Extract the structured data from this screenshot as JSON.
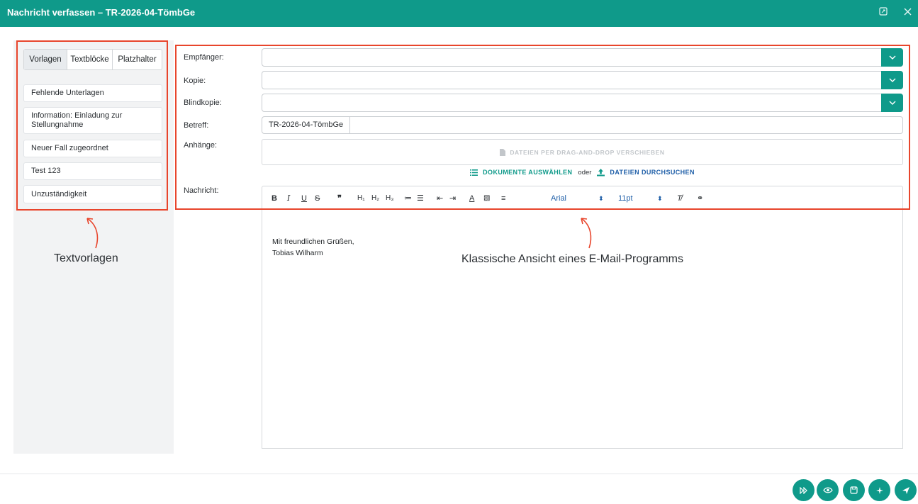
{
  "window": {
    "title": "Nachricht verfassen – TR-2026-04-TömbGe",
    "maximize_icon": "maximize-icon",
    "close_icon": "close-icon"
  },
  "sidebar": {
    "tabs": [
      {
        "label": "Vorlagen",
        "active": true
      },
      {
        "label": "Textblöcke",
        "active": false
      },
      {
        "label": "Platzhalter",
        "active": false
      }
    ],
    "templates": [
      {
        "label": "Fehlende Unterlagen"
      },
      {
        "label": "Information: Einladung zur Stellungnahme"
      },
      {
        "label": "Neuer Fall zugeordnet"
      },
      {
        "label": "Test 123"
      },
      {
        "label": "Unzuständigkeit"
      }
    ]
  },
  "form": {
    "recipient_label": "Empfänger:",
    "recipient_value": "",
    "cc_label": "Kopie:",
    "cc_value": "",
    "bcc_label": "Blindkopie:",
    "bcc_value": "",
    "subject_label": "Betreff:",
    "subject_value": "TR-2026-04-TömbGe",
    "attachments_label": "Anhänge:",
    "dropzone_text": "DATEIEN PER DRAG-AND-DROP VERSCHIEBEN",
    "select_documents": "DOKUMENTE AUSWÄHLEN",
    "or_text": "oder",
    "browse_files": "DATEIEN DURCHSUCHEN",
    "message_label": "Nachricht:"
  },
  "editor": {
    "font": "Arial",
    "size": "11pt",
    "body_lines": [
      "Mit freundlichen Grüßen,",
      "Tobias Wilharm"
    ]
  },
  "annotations": {
    "left": "Textvorlagen",
    "right": "Klassische Ansicht eines E-Mail-Programms"
  },
  "colors": {
    "accent": "#0f9a8a",
    "link_blue": "#1f5fa8",
    "annotation_red": "#e8452c"
  },
  "footer_actions": [
    "forward-icon",
    "preview-eye-icon",
    "save-icon",
    "magic-sparkle-icon",
    "send-icon"
  ]
}
